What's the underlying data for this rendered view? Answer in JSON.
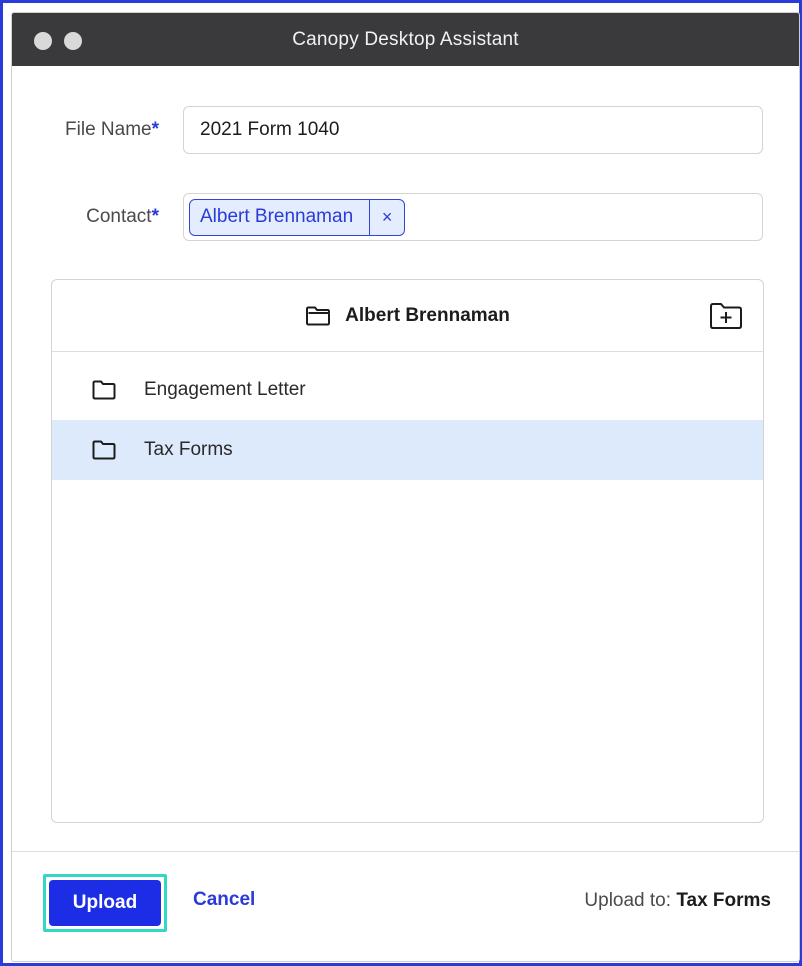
{
  "window": {
    "title": "Canopy Desktop Assistant"
  },
  "form": {
    "file_name_label": "File Name",
    "file_name_value": "2021 Form 1040",
    "contact_label": "Contact",
    "required_mark": "*",
    "contact_chip": "Albert Brennaman",
    "contact_chip_remove": "×"
  },
  "browser": {
    "current_folder": "Albert Brennaman",
    "folders": [
      {
        "name": "Engagement Letter",
        "selected": false
      },
      {
        "name": "Tax Forms",
        "selected": true
      }
    ]
  },
  "footer": {
    "upload_label": "Upload",
    "cancel_label": "Cancel",
    "upload_to_prefix": "Upload to:",
    "upload_to_target": "Tax Forms"
  },
  "colors": {
    "accent": "#2b3bd8",
    "primary_button": "#1d2de6",
    "selected_row": "#dceafc",
    "focus_ring": "#33d8c4",
    "titlebar": "#3a3a3c"
  },
  "icons": {
    "open_folder": "folder-open-icon",
    "new_folder": "folder-plus-icon",
    "folder": "folder-icon",
    "remove": "close-icon"
  }
}
